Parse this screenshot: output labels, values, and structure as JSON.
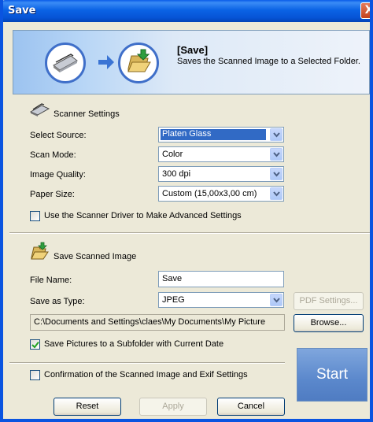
{
  "window": {
    "title": "Save",
    "close_glyph": "X"
  },
  "banner": {
    "title": "[Save]",
    "description": "Saves the Scanned Image to a Selected Folder."
  },
  "scanner_settings": {
    "heading": "Scanner Settings",
    "select_source": {
      "label": "Select Source:",
      "value": "Platen Glass"
    },
    "scan_mode": {
      "label": "Scan Mode:",
      "value": "Color"
    },
    "image_quality": {
      "label": "Image Quality:",
      "value": "300 dpi"
    },
    "paper_size": {
      "label": "Paper Size:",
      "value": "Custom (15,00x3,00 cm)"
    },
    "use_driver": {
      "label": "Use the Scanner Driver to Make Advanced Settings",
      "checked": false
    }
  },
  "save_image": {
    "heading": "Save Scanned Image",
    "file_name": {
      "label": "File Name:",
      "value": "Save"
    },
    "save_as_type": {
      "label": "Save as Type:",
      "value": "JPEG"
    },
    "pdf_settings_label": "PDF Settings...",
    "path": "C:\\Documents and Settings\\claes\\My Documents\\My Picture",
    "browse_label": "Browse...",
    "subfolder": {
      "label": "Save Pictures to a Subfolder with Current Date",
      "checked": true
    }
  },
  "footer": {
    "confirmation": {
      "label": "Confirmation of the Scanned Image and Exif Settings",
      "checked": false
    },
    "reset_label": "Reset",
    "apply_label": "Apply",
    "cancel_label": "Cancel",
    "start_label": "Start"
  },
  "colors": {
    "titlebar": "#0654d6",
    "selection": "#316ac5",
    "start_button": "#5b88cc"
  }
}
